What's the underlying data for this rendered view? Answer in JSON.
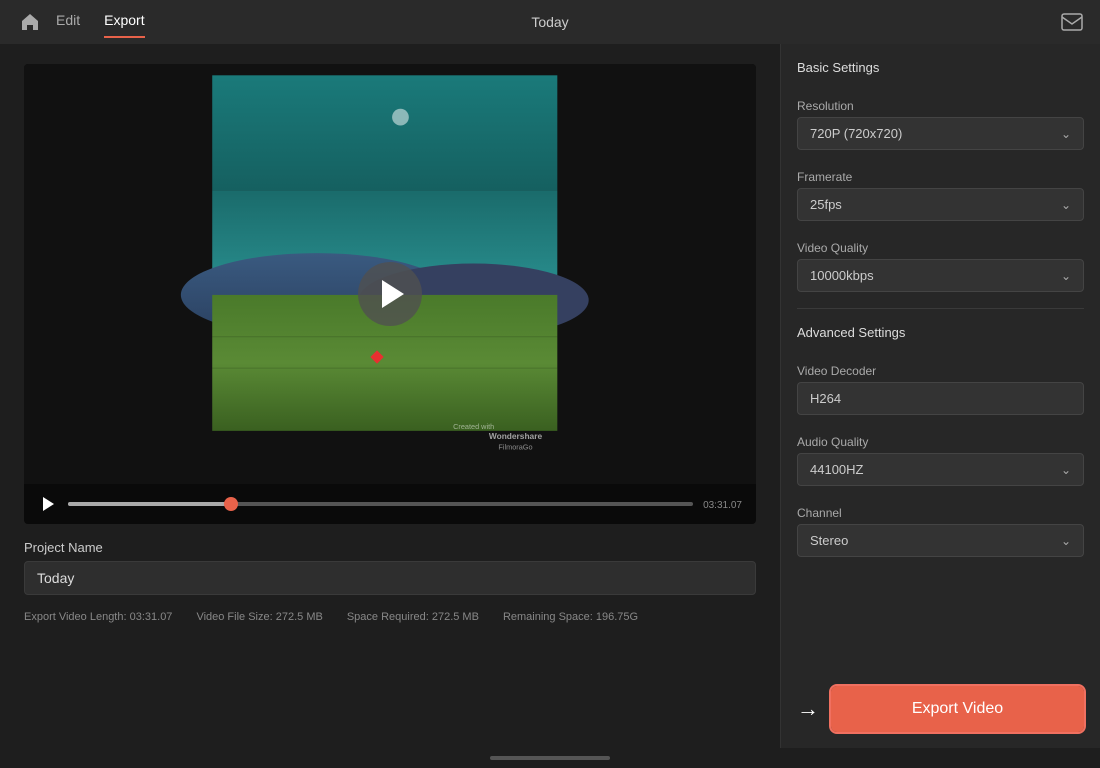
{
  "nav": {
    "home_icon": "⌂",
    "edit_label": "Edit",
    "export_label": "Export",
    "center_label": "Today",
    "mail_icon": "✉"
  },
  "video": {
    "time_current": "03:31",
    "time_suffix": ".07",
    "progress_percent": 26
  },
  "project": {
    "label": "Project Name",
    "name_value": "Today",
    "name_placeholder": "Today"
  },
  "export_info": {
    "length_label": "Export Video Length:",
    "length_value": "03:31.07",
    "filesize_label": "Video File Size:",
    "filesize_value": "272.5 MB",
    "space_required_label": "Space Required:",
    "space_required_value": "272.5 MB",
    "remaining_label": "Remaining Space:",
    "remaining_value": "196.75G"
  },
  "settings": {
    "basic_title": "Basic Settings",
    "resolution_label": "Resolution",
    "resolution_value": "720P (720x720)",
    "framerate_label": "Framerate",
    "framerate_value": "25fps",
    "video_quality_label": "Video Quality",
    "video_quality_value": "10000kbps",
    "advanced_title": "Advanced Settings",
    "video_decoder_label": "Video Decoder",
    "video_decoder_value": "H264",
    "audio_quality_label": "Audio Quality",
    "audio_quality_value": "44100HZ",
    "channel_label": "Channel",
    "channel_value": "Stereo"
  },
  "export_button": {
    "label": "Export Video",
    "arrow": "→"
  }
}
